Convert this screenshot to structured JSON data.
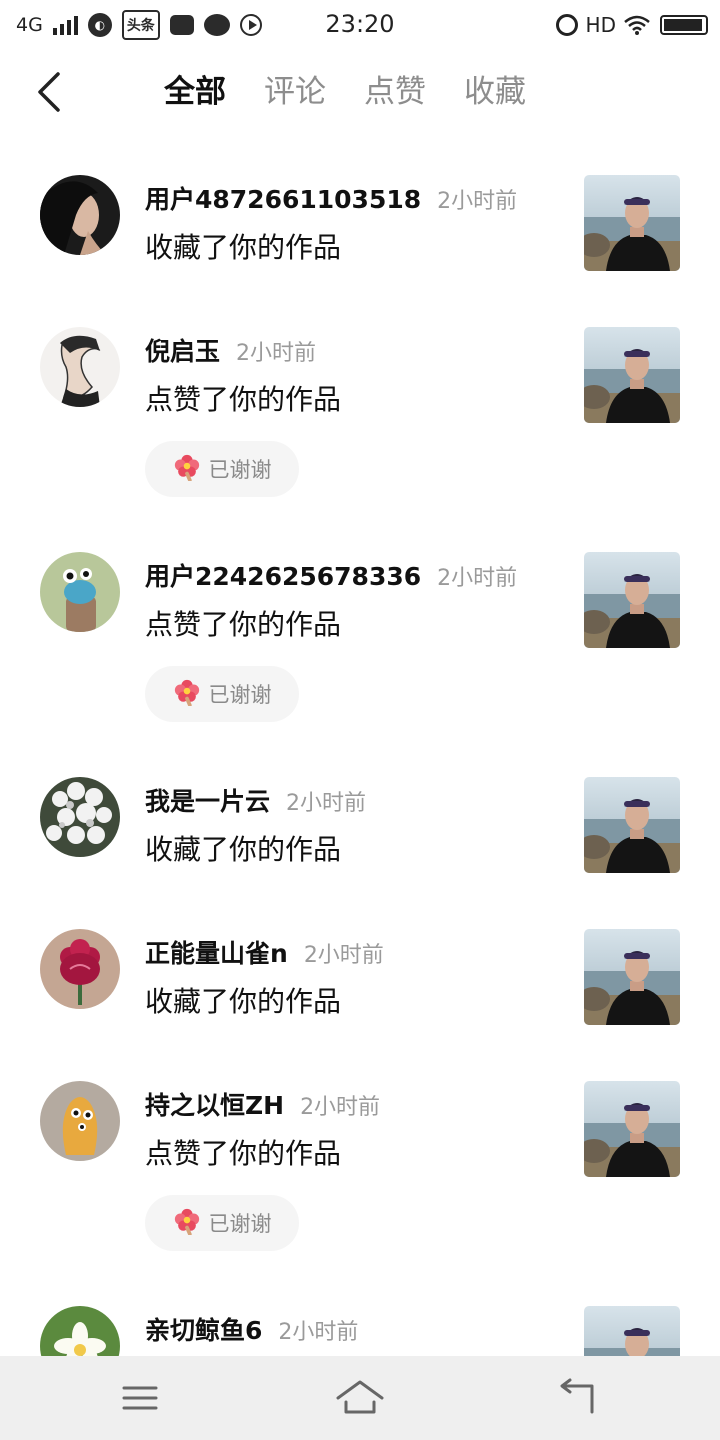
{
  "status_bar": {
    "network": "4G",
    "app_badge": "头条",
    "time": "23:20",
    "hd": "HD",
    "battery_level": 0.95
  },
  "header": {
    "tabs": [
      {
        "label": "全部",
        "active": true
      },
      {
        "label": "评论",
        "active": false
      },
      {
        "label": "点赞",
        "active": false
      },
      {
        "label": "收藏",
        "active": false
      }
    ]
  },
  "notifications": [
    {
      "user": "用户4872661103518",
      "time": "2小时前",
      "action": "收藏了你的作品",
      "thanked": false,
      "avatar": "portrait-woman-icon"
    },
    {
      "user": "倪启玉",
      "time": "2小时前",
      "action": "点赞了你的作品",
      "thanked": true,
      "thanks_label": "已谢谢",
      "avatar": "sketch-portrait-icon"
    },
    {
      "user": "用户2242625678336",
      "time": "2小时前",
      "action": "点赞了你的作品",
      "thanked": true,
      "thanks_label": "已谢谢",
      "avatar": "cartoon-creature-icon"
    },
    {
      "user": "我是一片云",
      "time": "2小时前",
      "action": "收藏了你的作品",
      "thanked": false,
      "avatar": "white-flowers-icon"
    },
    {
      "user": "正能量山雀n",
      "time": "2小时前",
      "action": "收藏了你的作品",
      "thanked": false,
      "avatar": "red-flower-icon"
    },
    {
      "user": "持之以恒ZH",
      "time": "2小时前",
      "action": "点赞了你的作品",
      "thanked": true,
      "thanks_label": "已谢谢",
      "avatar": "cartoon-bean-icon"
    },
    {
      "user": "亲切鲸鱼6",
      "time": "2小时前",
      "action": "",
      "thanked": false,
      "avatar": "frangipani-flower-icon"
    }
  ],
  "nav_bar": {
    "icons": [
      "menu-icon",
      "home-icon",
      "back-icon"
    ]
  },
  "colors": {
    "text_primary": "#111111",
    "text_secondary": "#9a9a9a",
    "pill_bg": "#f5f5f5",
    "nav_bg": "#efefef"
  }
}
